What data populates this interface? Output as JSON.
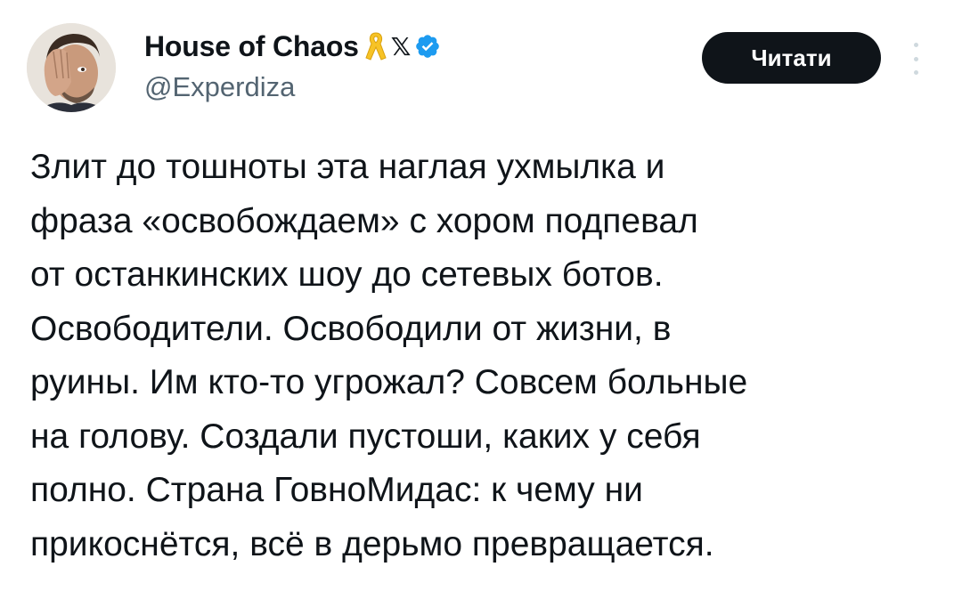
{
  "author": {
    "display_name": "House of Chaos",
    "handle": "@Experdiza",
    "badges": [
      "yellow-ribbon-icon",
      "x-affiliate-icon",
      "verified-badge-icon"
    ]
  },
  "actions": {
    "follow_label": "Читати",
    "more_icon": "more-vertical-icon"
  },
  "colors": {
    "button_bg": "#0f1419",
    "handle_gray": "#536471",
    "verified_blue": "#1d9bf0",
    "ribbon_yellow": "#f7c326"
  },
  "tweet": {
    "lines": [
      "Злит до тошноты эта наглая ухмылка и",
      "фраза «освобождаем» с хором подпевал",
      "от останкинских шоу до сетевых ботов.",
      "Освободители. Освободили от жизни, в",
      "руины. Им кто-то угрожал? Совсем больные",
      "на голову. Создали пустоши, каких у себя",
      "полно. Страна ГовноМидас: к чему ни",
      "прикоснётся, всё в дерьмо превращается."
    ]
  }
}
